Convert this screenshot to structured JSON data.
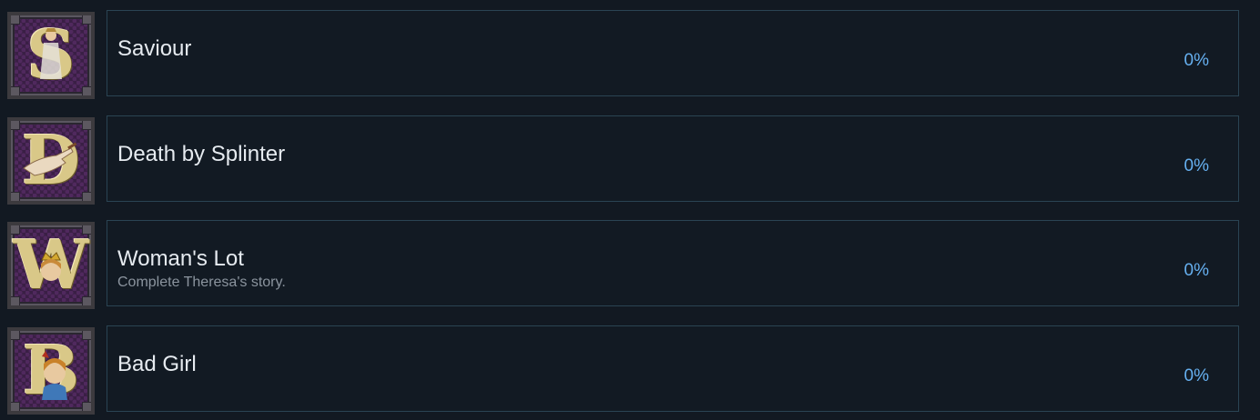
{
  "achievements": [
    {
      "title": "Saviour",
      "description": "",
      "percent": "0%",
      "icon": "letter-s-saviour-icon",
      "letter": "S"
    },
    {
      "title": "Death by Splinter",
      "description": "",
      "percent": "0%",
      "icon": "letter-d-hand-icon",
      "letter": "D"
    },
    {
      "title": "Woman's Lot",
      "description": "Complete Theresa's story.",
      "percent": "0%",
      "icon": "letter-w-crowned-woman-icon",
      "letter": "W"
    },
    {
      "title": "Bad Girl",
      "description": "",
      "percent": "0%",
      "icon": "letter-b-woman-icon",
      "letter": "B"
    }
  ],
  "colors": {
    "background": "#121922",
    "card_border": "#2a4453",
    "title": "#e6ebf0",
    "description": "#8b949e",
    "percent": "#66b0f0",
    "badge_bg": "#3a1f45",
    "badge_gold": "#d9c888"
  }
}
